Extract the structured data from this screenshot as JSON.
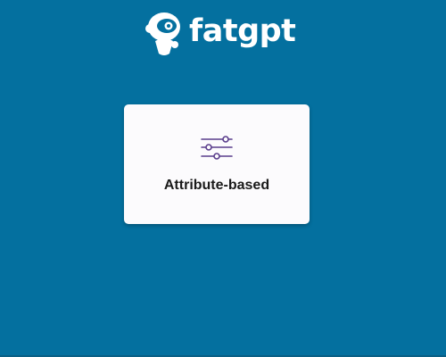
{
  "header": {
    "brand_name": "fatgpt",
    "logo_icon": "robot-mascot-icon"
  },
  "option_card": {
    "label": "Attribute-based",
    "icon": "sliders-icon",
    "icon_color": "#5a3d8c"
  },
  "colors": {
    "background": "#04709f",
    "card": "#fcfbfd",
    "text": "#1a1a1a"
  }
}
